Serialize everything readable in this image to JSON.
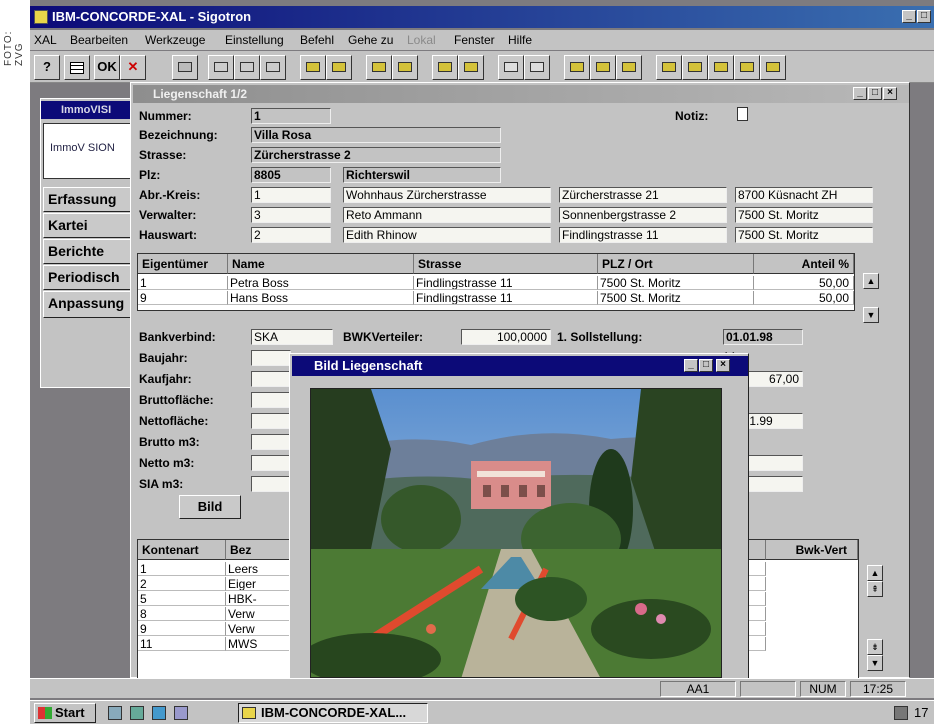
{
  "photo_credit": "FOTO: ZVG",
  "window": {
    "title": "IBM-CONCORDE-XAL - Sigotron"
  },
  "menu": [
    "XAL",
    "Bearbeiten",
    "Werkzeuge",
    "Einstellung",
    "Befehl",
    "Gehe zu",
    "Lokal",
    "Fenster",
    "Hilfe"
  ],
  "toolbar": {
    "help": "?",
    "ok": "OK",
    "cancel": "✕"
  },
  "side": {
    "title": "ImmoVISI",
    "logo": "ImmoV SION",
    "tabs": [
      "Erfassung",
      "Kartei",
      "Berichte",
      "Periodisch",
      "Anpassung"
    ]
  },
  "form": {
    "title": "Liegenschaft 1/2",
    "labels": {
      "nummer": "Nummer:",
      "bezeichnung": "Bezeichnung:",
      "strasse": "Strasse:",
      "plz": "Plz:",
      "abr_kreis": "Abr.-Kreis:",
      "verwalter": "Verwalter:",
      "hauswart": "Hauswart:",
      "notiz": "Notiz:",
      "bankverbind": "Bankverbind:",
      "bwk_verteiler": "BWKVerteiler:",
      "sollstellung": "1. Sollstellung:",
      "baujahr": "Baujahr:",
      "kaufjahr": "Kaufjahr:",
      "bruttoflaeche": "Bruttofläche:",
      "nettoflaeche": "Nettofläche:",
      "brutto_m3": "Brutto m3:",
      "netto_m3": "Netto m3:",
      "sia_m3": "SIA m3:"
    },
    "values": {
      "nummer": "1",
      "bezeichnung": "Villa Rosa",
      "strasse": "Zürcherstrasse 2",
      "plz": "8805",
      "ort": "Richterswil",
      "abr_kreis": "1",
      "abr_name": "Wohnhaus Zürcherstrasse",
      "abr_strasse": "Zürcherstrasse 21",
      "abr_ort": "8700 Küsnacht ZH",
      "verwalter": "3",
      "verwalter_name": "Reto Ammann",
      "verwalter_strasse": "Sonnenbergstrasse 2",
      "verwalter_ort": "7500 St. Moritz",
      "hauswart": "2",
      "hauswart_name": "Edith Rhinow",
      "hauswart_strasse": "Findlingstrasse 11",
      "hauswart_ort": "7500 St. Moritz",
      "bankverbind": "SKA",
      "bwk_verteiler": "100,0000",
      "sollstellung": "01.01.98",
      "right_value_1": "67,00",
      "right_value_2": "01.01.99",
      "check_mark": "✕"
    },
    "bild_button": "Bild"
  },
  "owners": {
    "headers": [
      "Eigentümer",
      "Name",
      "Strasse",
      "PLZ / Ort",
      "Anteil %"
    ],
    "rows": [
      [
        "1",
        "Petra Boss",
        "Findlingstrasse 11",
        "7500 St. Moritz",
        "50,00"
      ],
      [
        "9",
        "Hans Boss",
        "Findlingstrasse 11",
        "7500 St. Moritz",
        "50,00"
      ]
    ]
  },
  "konten": {
    "headers": [
      "Kontenart",
      "Bez",
      "Bwk-Vert"
    ],
    "rows": [
      [
        "1",
        "Leers"
      ],
      [
        "2",
        "Eiger"
      ],
      [
        "5",
        "HBK-"
      ],
      [
        "8",
        "Verw"
      ],
      [
        "9",
        "Verw"
      ],
      [
        "11",
        "MWS"
      ]
    ]
  },
  "popup": {
    "title": "Bild Liegenschaft"
  },
  "status": {
    "cell": "AA1",
    "num": "NUM",
    "time": "17:25"
  },
  "taskbar": {
    "start": "Start",
    "task": "IBM-CONCORDE-XAL...",
    "clock": "17"
  }
}
